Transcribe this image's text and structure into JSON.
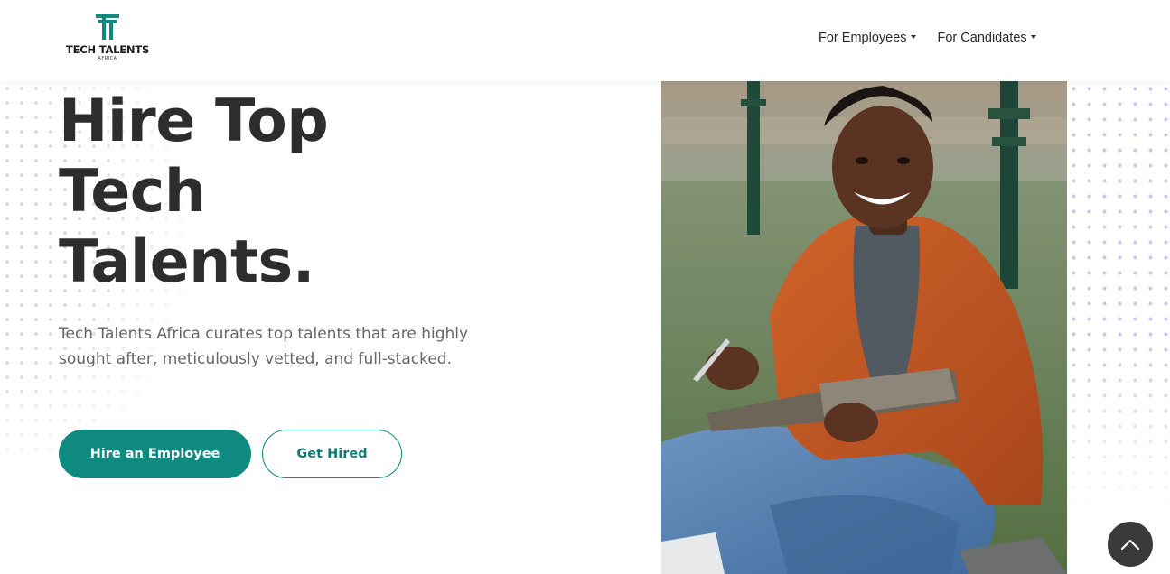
{
  "brand": {
    "name": "TECH TALENTS",
    "sub": "AFRICA",
    "accent": "#0e8a80"
  },
  "nav": {
    "items": [
      {
        "label": "For Employees"
      },
      {
        "label": "For Candidates"
      }
    ]
  },
  "hero": {
    "title_lines": [
      "Hire Top",
      "Tech",
      "Talents."
    ],
    "description": "Tech Talents Africa curates top talents that are highly sought after, meticulously vetted, and full-stacked.",
    "primary_button": "Hire an Employee",
    "secondary_button": "Get Hired",
    "image_alt": "smiling-student-with-notebook"
  },
  "icons": {
    "scroll_top": "chevron-up-icon",
    "dropdown": "caret-down-icon"
  }
}
